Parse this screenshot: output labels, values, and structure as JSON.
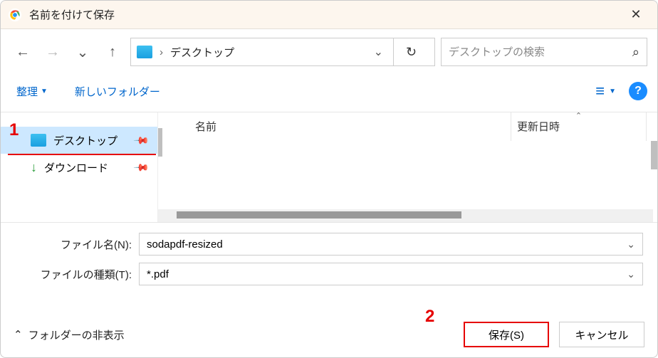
{
  "title": "名前を付けて保存",
  "path": {
    "label": "デスクトップ"
  },
  "search": {
    "placeholder": "デスクトップの検索"
  },
  "toolbar": {
    "organize": "整理",
    "newfolder": "新しいフォルダー"
  },
  "sidebar": {
    "items": [
      {
        "label": "デスクトップ"
      },
      {
        "label": "ダウンロード"
      }
    ]
  },
  "columns": {
    "name": "名前",
    "date": "更新日時"
  },
  "form": {
    "filename_label": "ファイル名(N):",
    "filename_value": "sodapdf-resized",
    "filetype_label": "ファイルの種類(T):",
    "filetype_value": "*.pdf"
  },
  "folders_toggle": "フォルダーの非表示",
  "buttons": {
    "save": "保存(S)",
    "cancel": "キャンセル"
  },
  "annotations": {
    "one": "1",
    "two": "2"
  }
}
